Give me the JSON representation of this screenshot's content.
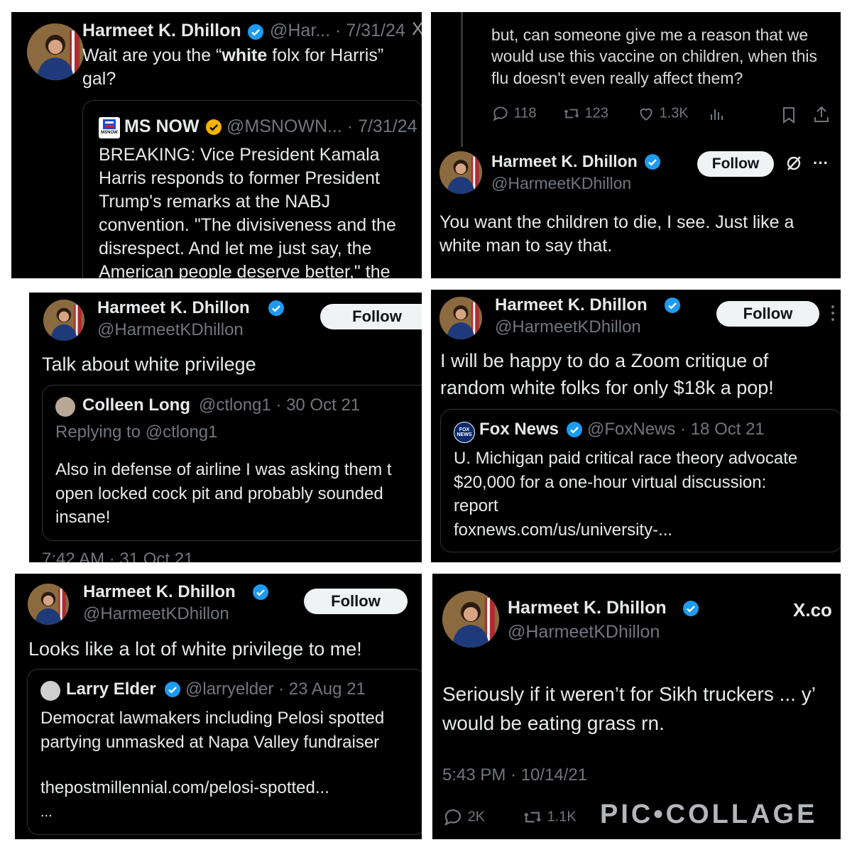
{
  "colors": {
    "panel_bg": "#000000",
    "text": "#e7e9ea",
    "muted": "#71767b",
    "verified_blue": "#1d9bf0",
    "verified_gold": "#f4b400",
    "border": "#2f3336",
    "follow_bg": "#eff3f4"
  },
  "watermark": "PIC•COLLAGE",
  "panel1": {
    "name": "Harmeet K. Dhillon",
    "handle_date": "@Har... · 7/31/24",
    "text_before": "Wait are you the “",
    "text_bold": "white",
    "text_after": " folx for Harris”",
    "text_line2": "gal?",
    "quote": {
      "logo_text": "MSNOW",
      "name": "MS NOW",
      "handle_date": "@MSNOWN... · 7/31/24",
      "lines": [
        "BREAKING: Vice President Kamala",
        "Harris responds to former President",
        "Trump's remarks at the NABJ",
        "convention. \"The divisiveness and the",
        "disrespect. And let me just say, the",
        "American people deserve better,\" the"
      ]
    }
  },
  "panel2": {
    "prev_lines": [
      "but, can someone give me a reason that we",
      "would use this vaccine on children, when this",
      "flu doesn't even really affect them?"
    ],
    "replies": "118",
    "reposts": "123",
    "likes": "1.3K",
    "name": "Harmeet K. Dhillon",
    "handle": "@HarmeetKDhillon",
    "follow_label": "Follow",
    "more": "···",
    "lines": [
      "You want the children to die, I see. Just like a",
      "white man to say that."
    ]
  },
  "panel3": {
    "name": "Harmeet K. Dhillon",
    "handle": "@HarmeetKDhillon",
    "follow_label": "Follow",
    "text": "Talk about white privilege",
    "quote": {
      "name": "Colleen Long",
      "handle_date": "@ctlong1 · 30 Oct 21",
      "replying": "Replying to @ctlong1",
      "lines": [
        "Also in defense of airline I was asking them t",
        "open locked cock pit and probably sounded",
        "insane!"
      ]
    },
    "timestamp": "7:42 AM · 31 Oct 21"
  },
  "panel4": {
    "name": "Harmeet K. Dhillon",
    "handle": "@HarmeetKDhillon",
    "follow_label": "Follow",
    "lines": [
      "I will be happy to do a Zoom critique of",
      "random white folks for only $18k a pop!"
    ],
    "quote": {
      "logo_text": "FOX NEWS",
      "name": "Fox News",
      "handle_date": "@FoxNews · 18 Oct 21",
      "lines": [
        "U. Michigan paid critical race theory advocate",
        "$20,000 for a one-hour virtual discussion:",
        "report",
        "foxnews.com/us/university-..."
      ]
    }
  },
  "panel5": {
    "name": "Harmeet K. Dhillon",
    "handle": "@HarmeetKDhillon",
    "follow_label": "Follow",
    "text": "Looks like a lot of white privilege to me!",
    "quote": {
      "name": "Larry Elder",
      "handle_date": "@larryelder · 23 Aug 21",
      "lines": [
        "Democrat lawmakers including Pelosi spotted",
        "partying unmasked at Napa Valley fundraiser"
      ],
      "link": "thepostmillennial.com/pelosi-spotted...",
      "ellipsis": "..."
    }
  },
  "panel6": {
    "name": "Harmeet K. Dhillon",
    "handle": "@HarmeetKDhillon",
    "xco": "X.co",
    "lines": [
      "Seriously if it weren’t for Sikh truckers ... y’",
      "would be eating grass rn."
    ],
    "timestamp": "5:43 PM · 10/14/21",
    "replies": "2K",
    "reposts": "1.1K"
  }
}
